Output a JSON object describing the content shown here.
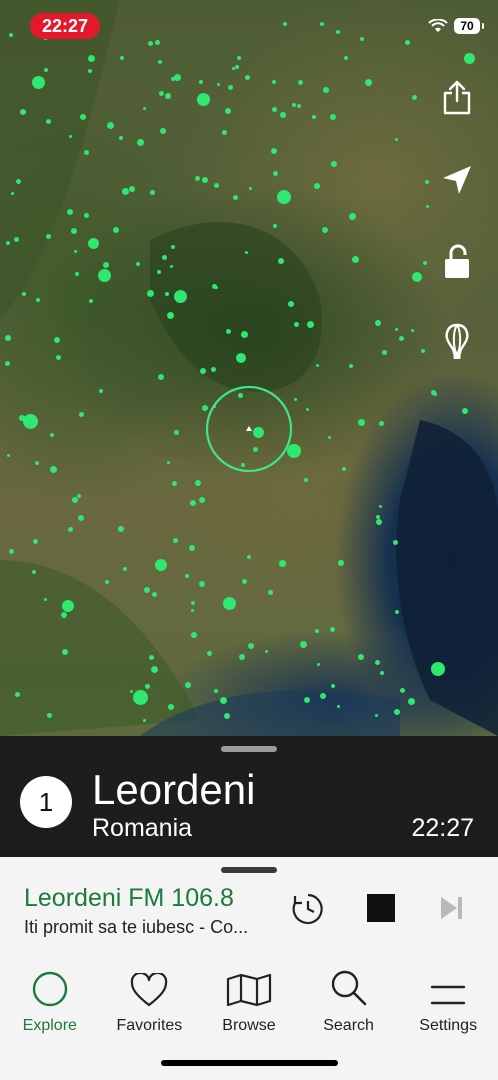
{
  "status_bar": {
    "time": "22:27",
    "battery": "70"
  },
  "map": {
    "icons": [
      "share-icon",
      "location-arrow-icon",
      "unlock-icon",
      "balloon-icon"
    ],
    "dot_color": "#2ee86f"
  },
  "city_panel": {
    "rank": "1",
    "city": "Leordeni",
    "country": "Romania",
    "local_time": "22:27"
  },
  "player": {
    "station": "Leordeni FM 106.8",
    "song": "Iti promit sa te iubesc - Co...",
    "accent": "#1c7a3a"
  },
  "tabs": [
    {
      "label": "Explore",
      "icon": "circle-icon",
      "active": true
    },
    {
      "label": "Favorites",
      "icon": "heart-icon",
      "active": false
    },
    {
      "label": "Browse",
      "icon": "map-icon",
      "active": false
    },
    {
      "label": "Search",
      "icon": "search-icon",
      "active": false
    },
    {
      "label": "Settings",
      "icon": "menu-icon",
      "active": false
    }
  ]
}
